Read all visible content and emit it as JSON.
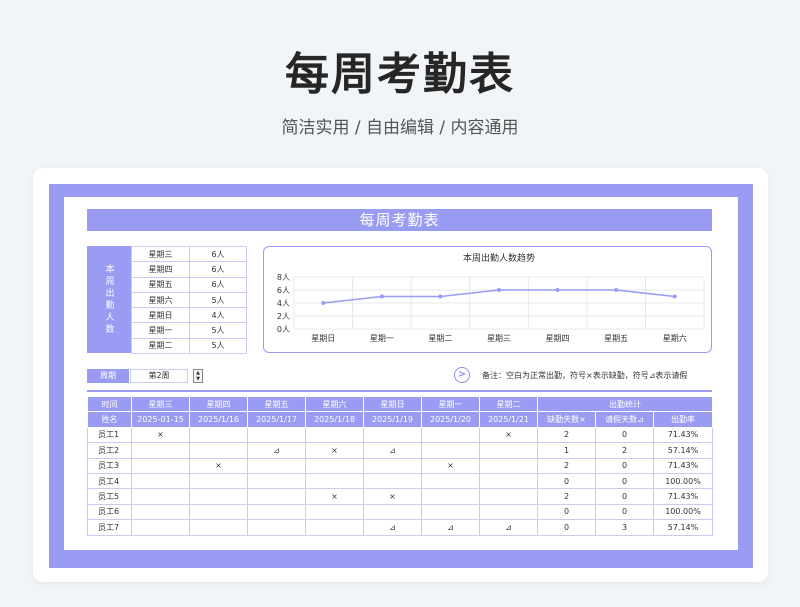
{
  "hero": {
    "title": "每周考勤表",
    "subtitle": "简洁实用 / 自由编辑 / 内容通用"
  },
  "sheet": {
    "banner": "每周考勤表",
    "summary_label": "本周出勤人数",
    "summary": [
      {
        "day": "星期三",
        "count": "6人"
      },
      {
        "day": "星期四",
        "count": "6人"
      },
      {
        "day": "星期五",
        "count": "6人"
      },
      {
        "day": "星期六",
        "count": "5人"
      },
      {
        "day": "星期日",
        "count": "4人"
      },
      {
        "day": "星期一",
        "count": "5人"
      },
      {
        "day": "星期二",
        "count": "5人"
      }
    ],
    "week_label": "周期",
    "week_value": "第2周",
    "note": "备注：空白为正常出勤，符号×表示缺勤，符号⊿表示请假",
    "table": {
      "row1": [
        "时间",
        "星期三",
        "星期四",
        "星期五",
        "星期六",
        "星期日",
        "星期一",
        "星期二",
        "出勤统计"
      ],
      "row2": [
        "姓名",
        "2025-01-15",
        "2025/1/16",
        "2025/1/17",
        "2025/1/18",
        "2025/1/19",
        "2025/1/20",
        "2025/1/21",
        "缺勤天数×",
        "请假天数⊿",
        "出勤率"
      ],
      "rows": [
        [
          "员工1",
          "×",
          "",
          "",
          "",
          "",
          "",
          "×",
          "2",
          "0",
          "71.43%"
        ],
        [
          "员工2",
          "",
          "",
          "⊿",
          "×",
          "⊿",
          "",
          "",
          "1",
          "2",
          "57.14%"
        ],
        [
          "员工3",
          "",
          "×",
          "",
          "",
          "",
          "×",
          "",
          "2",
          "0",
          "71.43%"
        ],
        [
          "员工4",
          "",
          "",
          "",
          "",
          "",
          "",
          "",
          "0",
          "0",
          "100.00%"
        ],
        [
          "员工5",
          "",
          "",
          "",
          "×",
          "×",
          "",
          "",
          "2",
          "0",
          "71.43%"
        ],
        [
          "员工6",
          "",
          "",
          "",
          "",
          "",
          "",
          "",
          "0",
          "0",
          "100.00%"
        ],
        [
          "员工7",
          "",
          "",
          "",
          "",
          "⊿",
          "⊿",
          "⊿",
          "0",
          "3",
          "57.14%"
        ]
      ]
    }
  },
  "chart_data": {
    "type": "line",
    "title": "本周出勤人数趋势",
    "categories": [
      "星期日",
      "星期一",
      "星期二",
      "星期三",
      "星期四",
      "星期五",
      "星期六"
    ],
    "values": [
      4,
      5,
      5,
      6,
      6,
      6,
      5
    ],
    "ylim": [
      0,
      8
    ],
    "yticks": [
      "0人",
      "2人",
      "4人",
      "6人",
      "8人"
    ],
    "grid": true,
    "line_color": "#9a9cf4"
  }
}
